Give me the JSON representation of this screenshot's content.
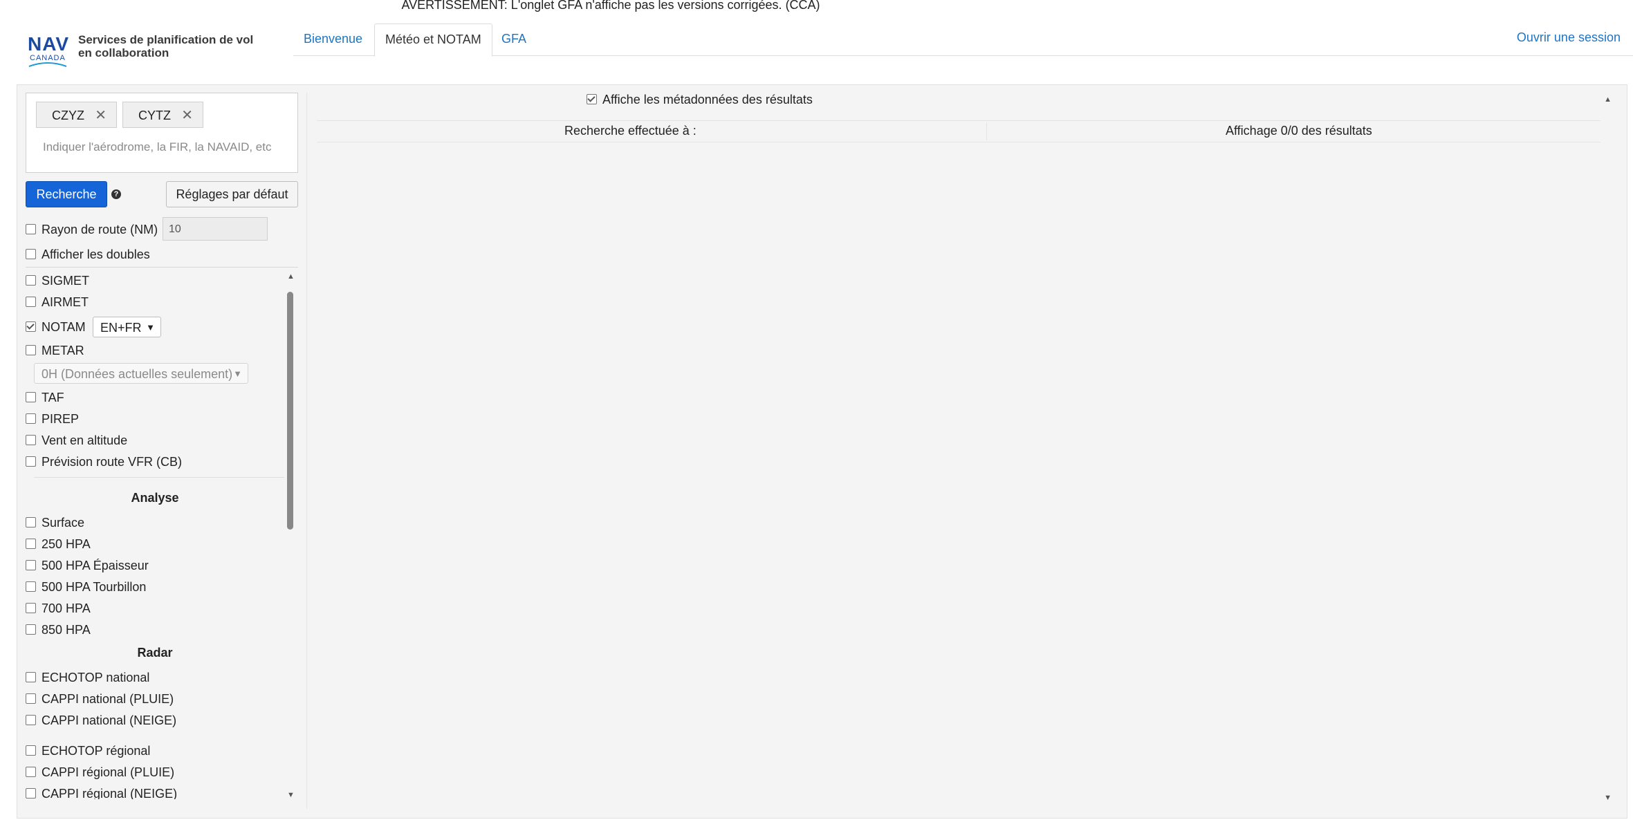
{
  "banner": {
    "warning": "AVERTISSEMENT: L'onglet GFA n'affiche pas les versions corrigées. (CCA)"
  },
  "brand": {
    "logo_top": "NAV",
    "logo_bottom": "CANADA",
    "line1": "Services de planification de vol",
    "line2": "en collaboration"
  },
  "tabs": [
    {
      "label": "Bienvenue",
      "active": false
    },
    {
      "label": "Météo et NOTAM",
      "active": true
    },
    {
      "label": "GFA",
      "active": false
    }
  ],
  "login_label": "Ouvrir une session",
  "search": {
    "chips": [
      "CZYZ",
      "CYTZ"
    ],
    "placeholder": "Indiquer l'aérodrome, la FIR, la NAVAID, etc",
    "search_button": "Recherche",
    "defaults_button": "Réglages par défaut"
  },
  "options": {
    "route_radius_label": "Rayon de route (NM)",
    "route_radius_value": "10",
    "show_duplicates_label": "Afficher les doubles"
  },
  "products": {
    "sigmet": "SIGMET",
    "airmet": "AIRMET",
    "notam": "NOTAM",
    "notam_lang": "EN+FR",
    "metar": "METAR",
    "metar_range": "0H (Données actuelles seulement)",
    "taf": "TAF",
    "pirep": "PIREP",
    "upper_wind": "Vent en altitude",
    "vfr_route": "Prévision route VFR (CB)"
  },
  "analysis": {
    "title": "Analyse",
    "items": [
      "Surface",
      "250 HPA",
      "500 HPA Épaisseur",
      "500 HPA Tourbillon",
      "700 HPA",
      "850 HPA"
    ]
  },
  "radar": {
    "title": "Radar",
    "national": [
      "ECHOTOP national",
      "CAPPI national (PLUIE)",
      "CAPPI national (NEIGE)"
    ],
    "regional": [
      "ECHOTOP régional",
      "CAPPI régional (PLUIE)",
      "CAPPI régional (NEIGE)"
    ]
  },
  "results": {
    "metadata_label": "Affiche les métadonnées des résultats",
    "searched_at": "Recherche effectuée à :",
    "display_count": "Affichage 0/0 des résultats"
  },
  "colors": {
    "link": "#1f74c1",
    "primary_button": "#1565d8",
    "brand": "#1b4a9e"
  }
}
